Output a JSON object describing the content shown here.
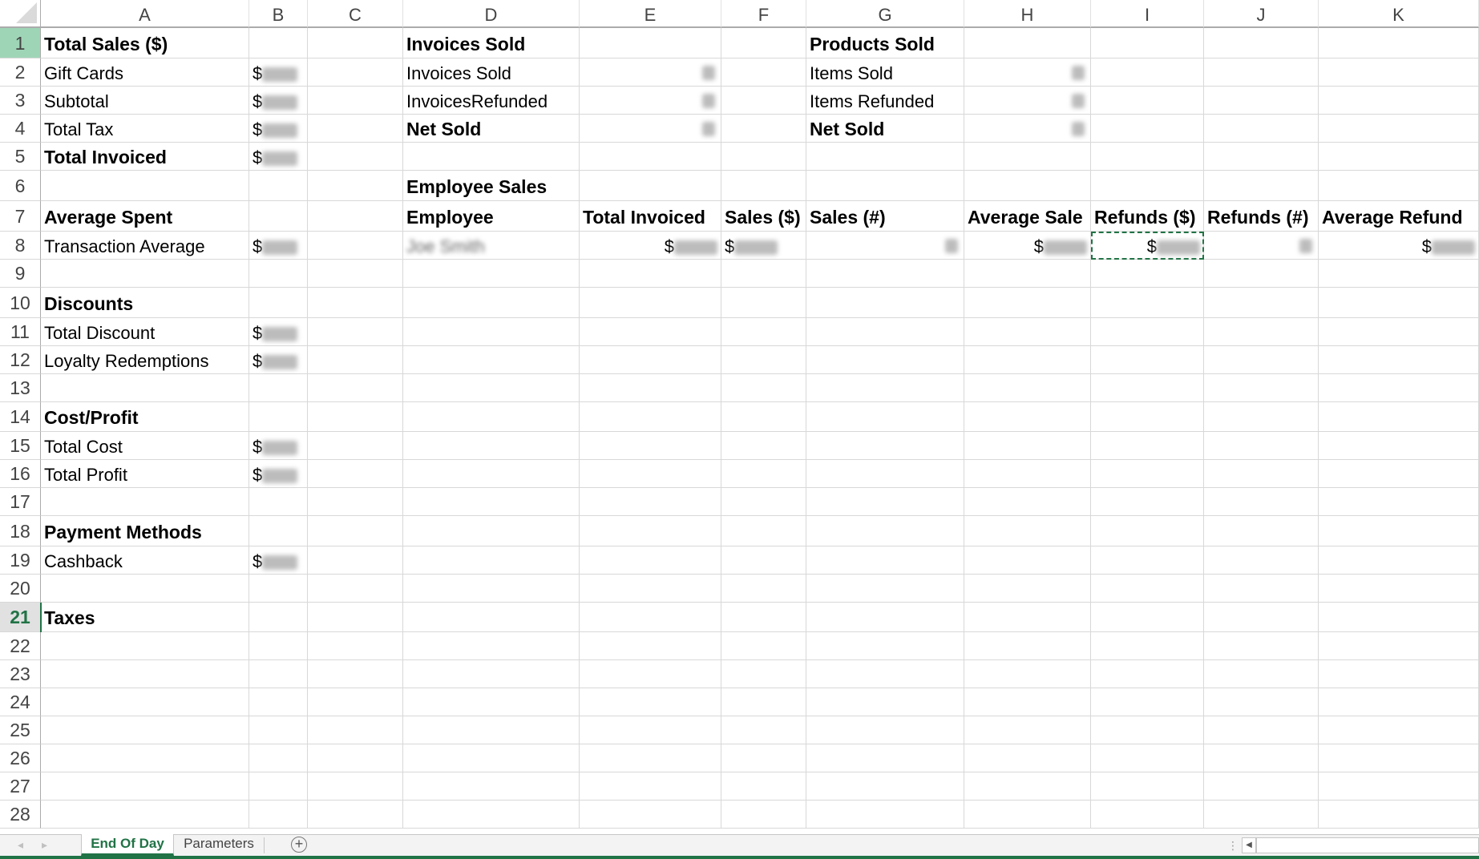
{
  "columns": [
    "A",
    "B",
    "C",
    "D",
    "E",
    "F",
    "G",
    "H",
    "I",
    "J",
    "K"
  ],
  "rows": [
    1,
    2,
    3,
    4,
    5,
    6,
    7,
    8,
    9,
    10,
    11,
    12,
    13,
    14,
    15,
    16,
    17,
    18,
    19,
    20,
    21,
    22,
    23,
    24,
    25,
    26,
    27,
    28
  ],
  "active_row": 21,
  "highlighted_row_header": 1,
  "copy_cell": "I8",
  "cells": {
    "A1": "Total Sales ($)",
    "A2": "Gift Cards",
    "A3": "Subtotal",
    "A4": "Total Tax",
    "A5": "Total Invoiced",
    "A7": "Average Spent",
    "A8": "Transaction Average",
    "A10": "Discounts",
    "A11": "Total Discount",
    "A12": "Loyalty Redemptions",
    "A14": "Cost/Profit",
    "A15": "Total Cost",
    "A16": "Total Profit",
    "A18": "Payment Methods",
    "A19": "Cashback",
    "A21": "Taxes",
    "B2": "$",
    "B3": "$",
    "B4": "$",
    "B5": "$",
    "B8": "$",
    "B11": "$",
    "B12": "$",
    "B15": "$",
    "B16": "$",
    "B19": "$",
    "D1": "Invoices Sold",
    "D2": "Invoices Sold",
    "D3": "InvoicesRefunded",
    "D4": "Net Sold",
    "D6": "Employee Sales",
    "D7": "Employee",
    "D8": "Joe Smith",
    "E7": "Total Invoiced",
    "E8": "$",
    "F7": "Sales ($)",
    "F8": "$",
    "G1": "Products Sold",
    "G2": "Items Sold",
    "G3": "Items Refunded",
    "G4": "Net Sold",
    "G7": "Sales (#)",
    "H7": "Average Sale",
    "H8": "$",
    "I7": "Refunds ($)",
    "I8": "$",
    "J7": "Refunds (#)",
    "K7": "Average Refund",
    "K8": "$"
  },
  "redacted_note": "values obscured",
  "sheet_tabs": [
    {
      "label": "End Of Day",
      "active": true
    },
    {
      "label": "Parameters",
      "active": false
    }
  ],
  "icons": {
    "tab_prev": "◂",
    "tab_next": "▸",
    "add_sheet": "+",
    "more": "⋮",
    "scroll_left": "◀"
  },
  "colors": {
    "accent": "#217346",
    "row_header_highlight": "#9fd5b7"
  }
}
